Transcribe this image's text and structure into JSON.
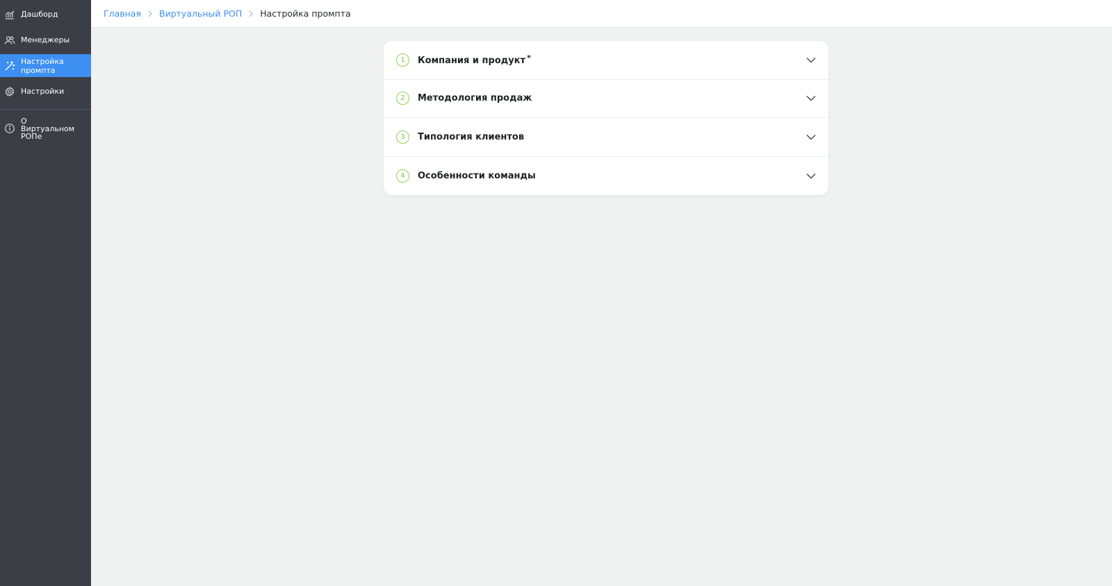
{
  "sidebar": {
    "items": [
      {
        "label": "Дашборд",
        "icon": "chart-icon",
        "active": false
      },
      {
        "label": "Менеджеры",
        "icon": "users-icon",
        "active": false
      },
      {
        "label": "Настройка промпта",
        "icon": "magic-wand-icon",
        "active": true
      },
      {
        "label": "Настройки",
        "icon": "gear-icon",
        "active": false
      }
    ],
    "footer_item": {
      "label": "О Виртуальном РОПе",
      "icon": "info-icon"
    }
  },
  "breadcrumb": {
    "items": [
      "Главная",
      "Виртуальный РОП"
    ],
    "current": "Настройка промпта"
  },
  "accordion": {
    "sections": [
      {
        "number": "1",
        "title": "Компания и продукт",
        "required_mark": "*"
      },
      {
        "number": "2",
        "title": "Методология продаж"
      },
      {
        "number": "3",
        "title": "Типология клиентов"
      },
      {
        "number": "4",
        "title": "Особенности команды"
      }
    ]
  },
  "colors": {
    "sidebar_bg": "#3b3e45",
    "accent": "#3d8ff2",
    "step_green": "#8fd14f",
    "page_bg": "#f0f1f1"
  }
}
